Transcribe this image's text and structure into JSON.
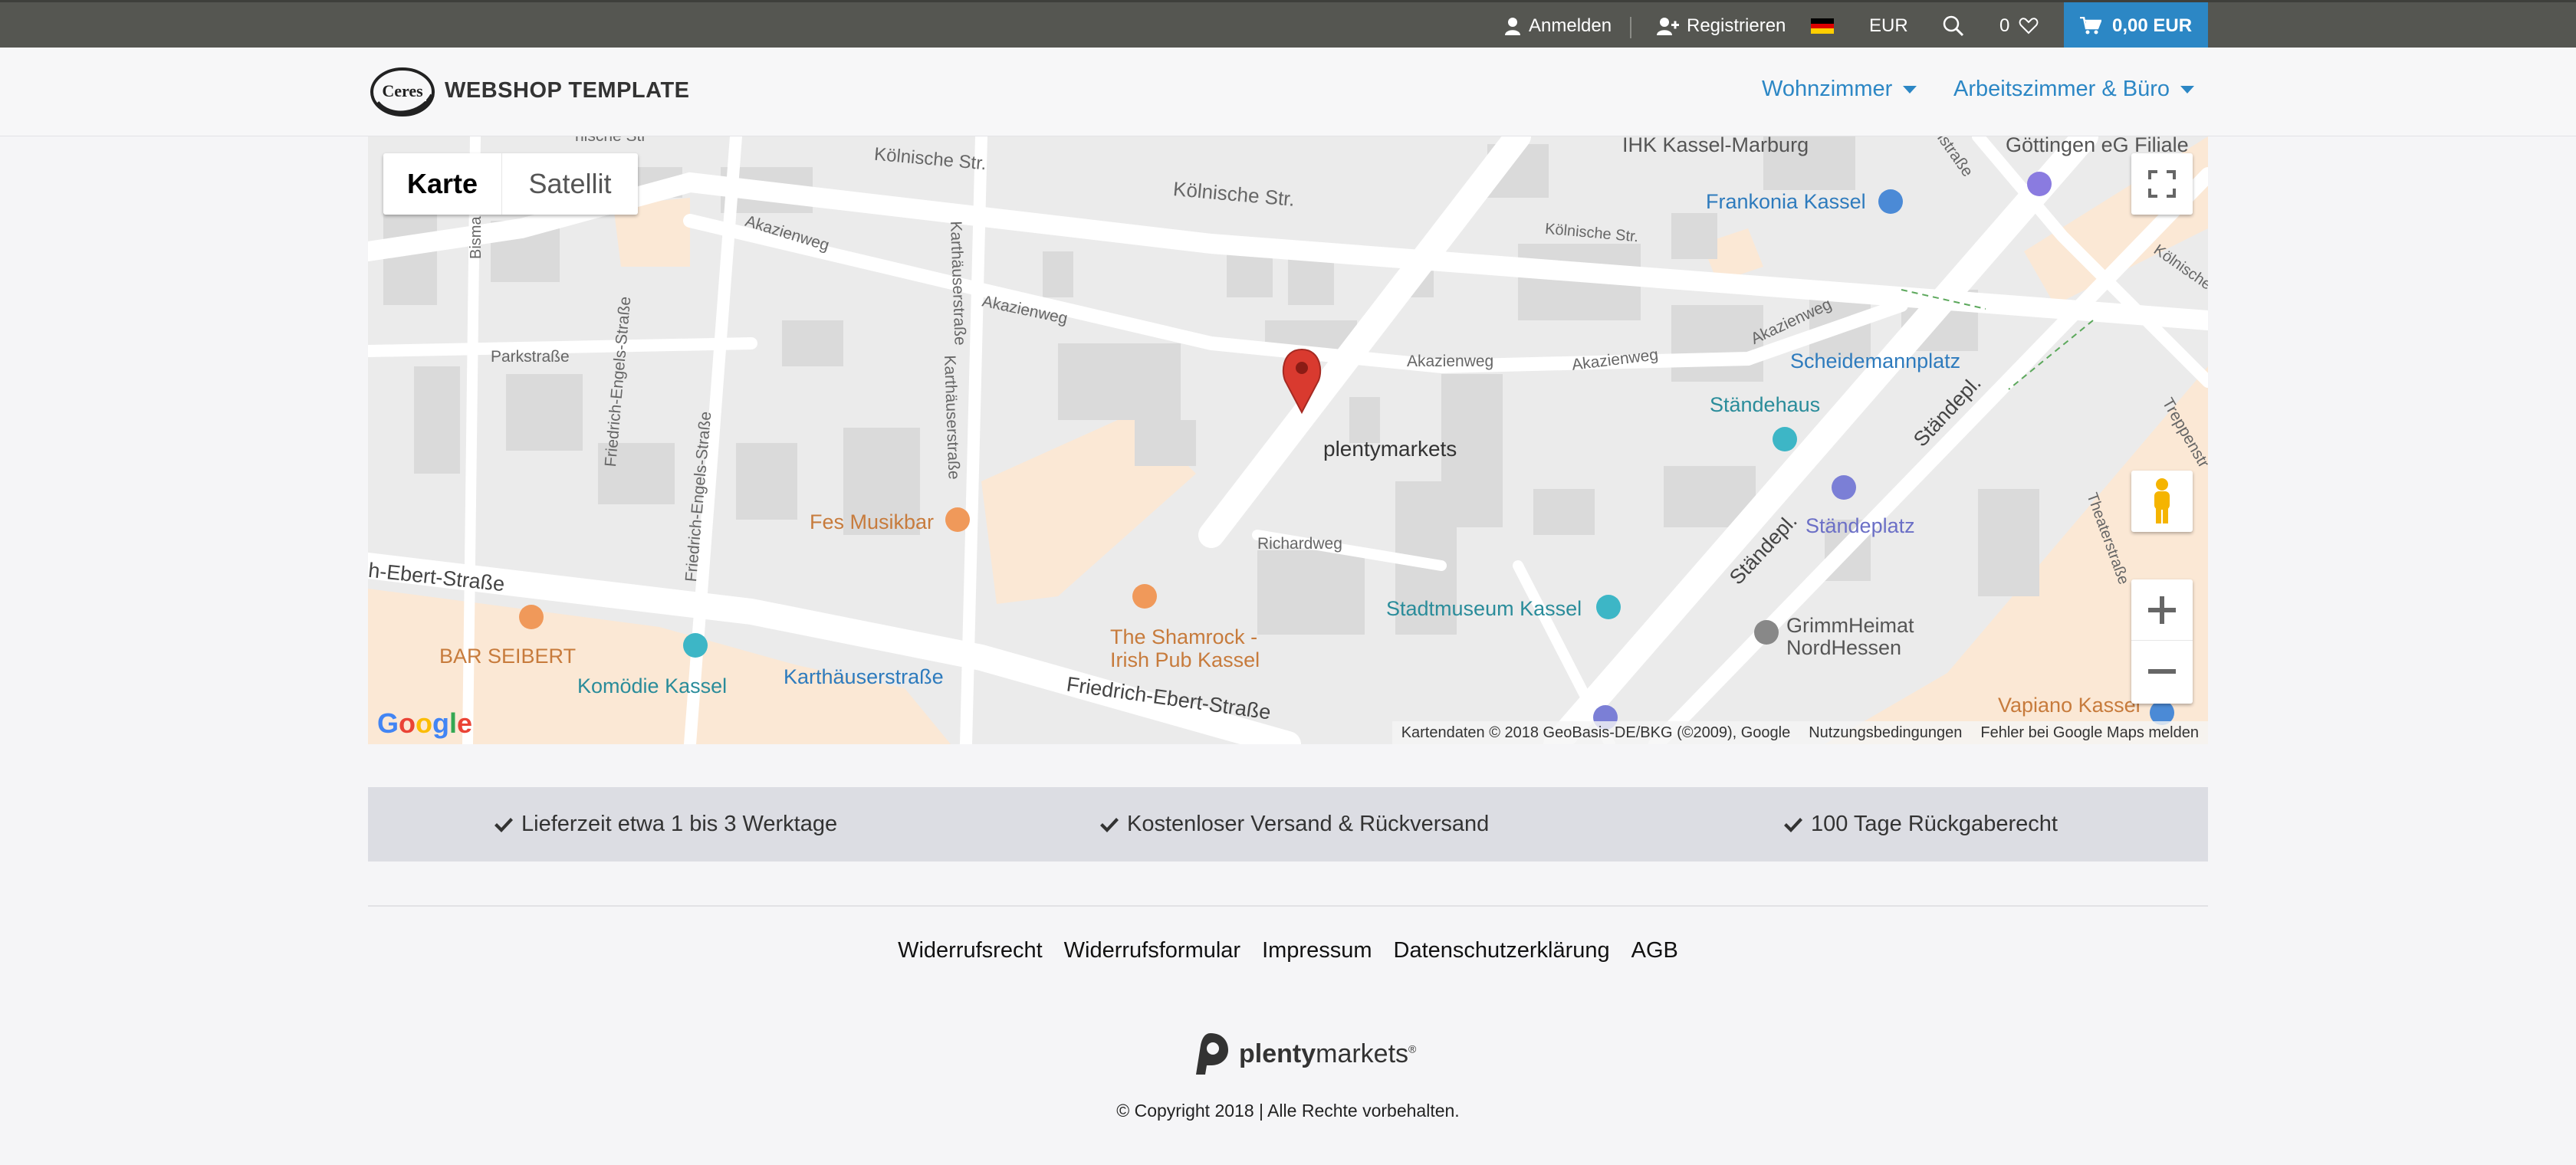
{
  "topbar": {
    "login": "Anmelden",
    "register": "Registrieren",
    "currency": "EUR",
    "wishlist_count": "0",
    "cart_total": "0,00 EUR",
    "bg_color": "#555651",
    "cart_color": "#2c87c5"
  },
  "header": {
    "logo_text": "Ceres",
    "brand": "WEBSHOP TEMPLATE",
    "nav": [
      {
        "label": "Wohnzimmer"
      },
      {
        "label": "Arbeitszimmer & Büro"
      }
    ],
    "accent_color": "#2c87c5"
  },
  "map": {
    "type_buttons": [
      "Karte",
      "Satellit"
    ],
    "marker_label": "plentymarkets",
    "street_labels": [
      "Kölnische Str.",
      "Kölnische Str.",
      "Kölnische Str.",
      "Kölnische Str.",
      "Akazienweg",
      "Akazienweg",
      "Akazienweg",
      "Akazienweg",
      "Akazienweg",
      "Parkstraße",
      "Friedrich-Engels-Straße",
      "Friedrich-Engels-Straße",
      "Karthäuserstraße",
      "Karthäuserstraße",
      "Richardweg",
      "Friedrich-Ebert-Straße",
      "h-Ebert-Straße",
      "Ständepl.",
      "Ständepl.",
      "Theaterstraße",
      "Treppenstr",
      "Bisma",
      "nische Str",
      "stenstraße"
    ],
    "poi_labels": [
      "IHK Kassel-Marburg",
      "Göttingen eG Filiale",
      "Frankonia Kassel",
      "Scheidemannplatz",
      "Ständehaus",
      "Ständeplatz",
      "Fes Musikbar",
      "The Shamrock -",
      "Irish Pub Kassel",
      "Stadtmuseum Kassel",
      "GrimmHeimat",
      "NordHessen",
      "BAR SEIBERT",
      "Komödie Kassel",
      "Karthäuserstraße",
      "Vapiano Kassel"
    ],
    "attribution": [
      "Kartendaten © 2018 GeoBasis-DE/BKG (©2009), Google",
      "Nutzungsbedingungen",
      "Fehler bei Google Maps melden"
    ],
    "google_logo": "Google"
  },
  "usp": [
    {
      "label": "Lieferzeit etwa 1 bis 3 Werktage"
    },
    {
      "label": "Kostenloser Versand & Rückversand"
    },
    {
      "label": "100 Tage Rückgaberecht"
    }
  ],
  "footer": {
    "links": [
      "Widerrufsrecht",
      "Widerrufsformular",
      "Impressum",
      "Datenschutzerklärung",
      "AGB"
    ],
    "plenty_logo_bold": "plenty",
    "plenty_logo_rest": "markets",
    "copyright": "© Copyright 2018 | Alle Rechte vorbehalten."
  }
}
